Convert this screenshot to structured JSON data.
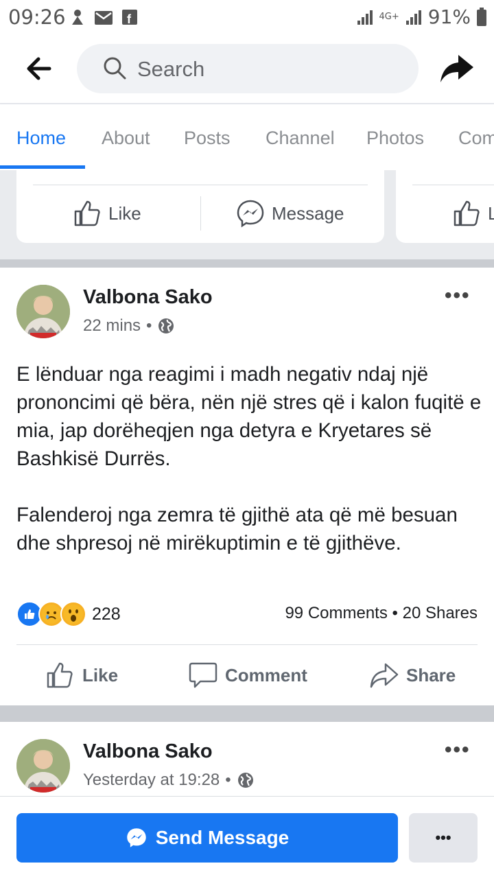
{
  "status_bar": {
    "time": "09:26",
    "network": "4G+",
    "battery": "91%"
  },
  "header": {
    "search_placeholder": "Search"
  },
  "tabs": [
    "Home",
    "About",
    "Posts",
    "Channel",
    "Photos",
    "Com"
  ],
  "page_cards": {
    "like_label": "Like",
    "message_label": "Message",
    "partial_like": "L"
  },
  "posts": [
    {
      "author": "Valbona Sako",
      "time": "22 mins",
      "paragraphs": [
        "E lënduar nga reagimi i madh negativ ndaj një prononcimi që bëra, nën një stres që i kalon fuqitë e mia, jap dorëheqjen nga detyra e Kryetares së Bashkisë Durrës.",
        "Falenderoj nga zemra të gjithë ata që më besuan dhe shpresoj në mirëkuptimin e të gjithëve."
      ],
      "reaction_count": "228",
      "comments": "99 Comments",
      "shares": "20 Shares",
      "actions": {
        "like": "Like",
        "comment": "Comment",
        "share": "Share"
      }
    },
    {
      "author": "Valbona Sako",
      "time": "Yesterday at 19:28"
    }
  ],
  "bottom_bar": {
    "send_message": "Send Message",
    "more": "•••"
  },
  "colors": {
    "accent": "#1877f2",
    "gray_bg": "#c9ccd1",
    "text_secondary": "#65676b"
  }
}
